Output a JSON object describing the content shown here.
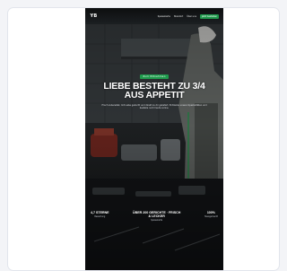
{
  "nav": {
    "logo": "YB",
    "links": [
      "Speisekarte",
      "Standort",
      "Über uns"
    ],
    "cta": "Jetzt bestellen"
  },
  "hero": {
    "badge": "Zum Mitnehmen",
    "headline": "Liebe besteht zu 3/4 aus Appetit",
    "subtext": "Frisch zubereitet, mit Liebe gekocht und direkt zu dir geliefert. Entdecke unsere Spezialitäten und bestelle noch heute online."
  },
  "stats": [
    {
      "value": "4,7 Sterne",
      "label": "Bewertung"
    },
    {
      "value": "Über 200 Gerichte · Frisch & Lecker",
      "label": "Speisekarte"
    },
    {
      "value": "100%",
      "label": "Hausgemacht"
    }
  ],
  "colors": {
    "accent": "#1f9a4c",
    "page_bg": "#f3f4f7",
    "hero_bg": "#1c2025"
  }
}
